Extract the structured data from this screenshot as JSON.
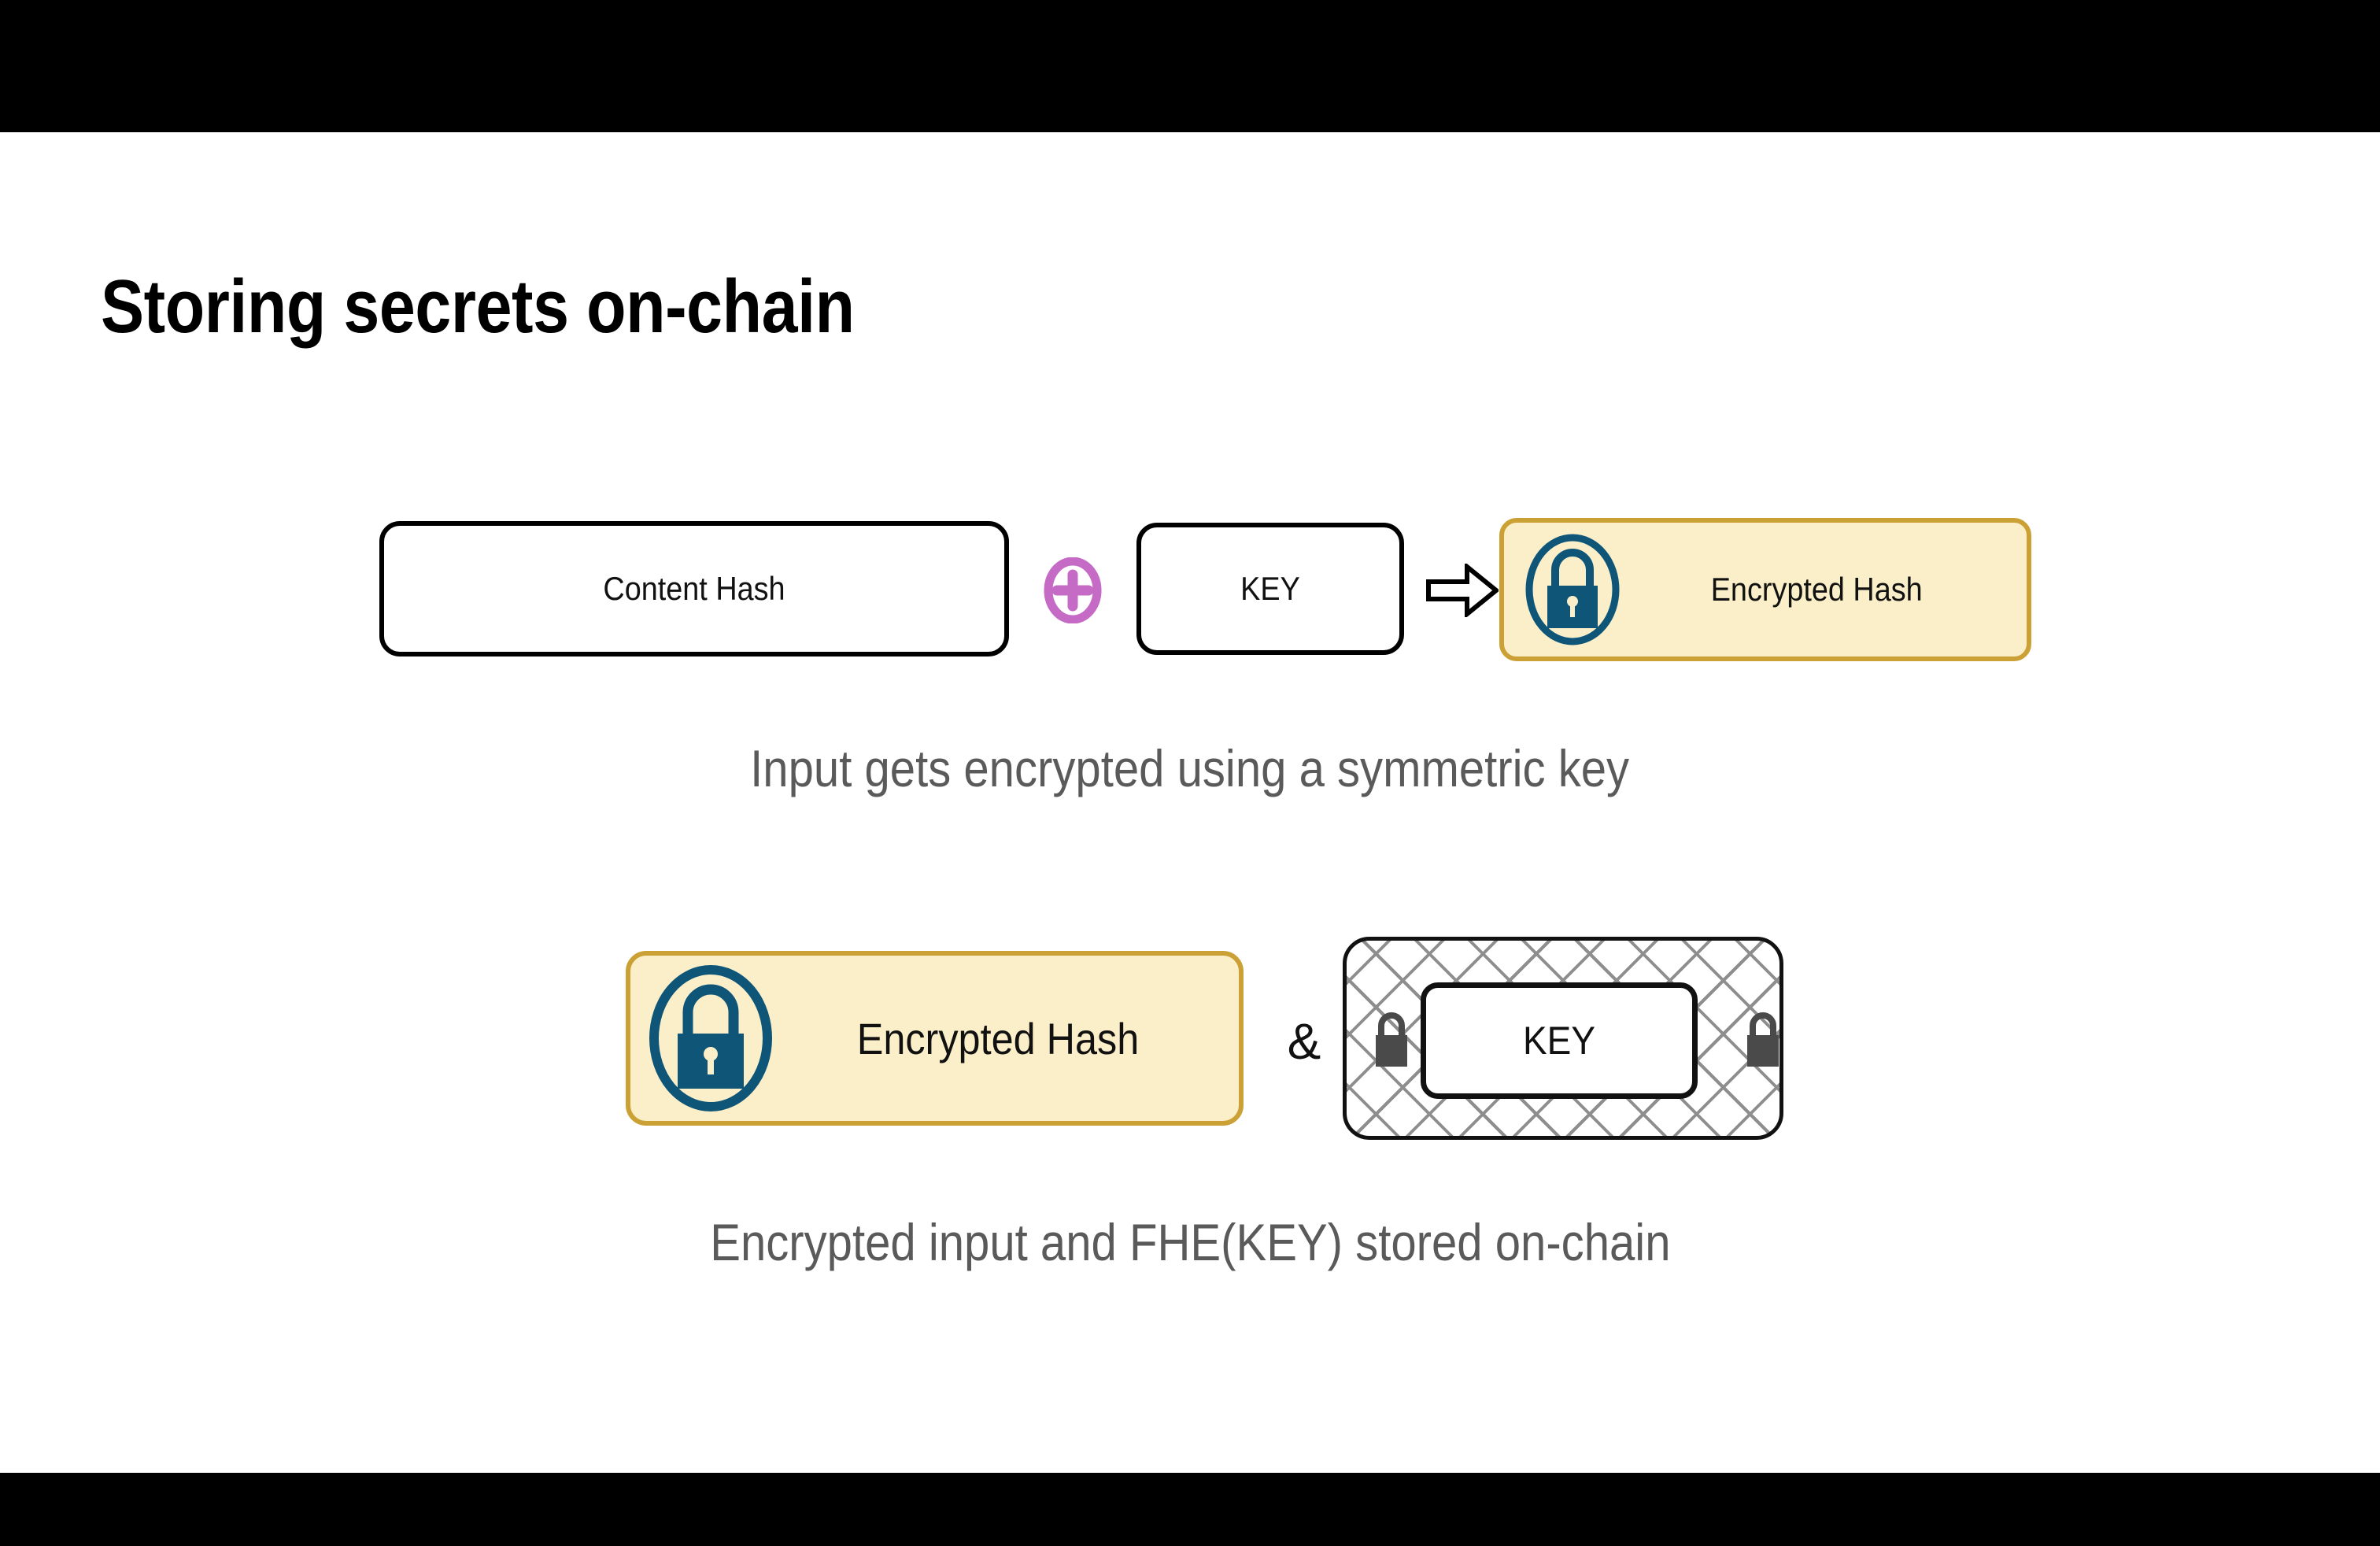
{
  "slide": {
    "title": "Storing secrets on-chain",
    "background_color": "#FFFFFF",
    "letterbox_color": "#000000"
  },
  "diagram": {
    "row1": {
      "content_hash_label": "Content Hash",
      "plus_operator": "plus-circle",
      "key_label": "KEY",
      "arrow": "right-block-arrow",
      "encrypted_hash_label": "Encrypted Hash",
      "lock_icon": "lock-in-circle-icon",
      "caption": "Input gets encrypted using a symmetric key",
      "accent_fill": "#FBEFC9",
      "accent_border": "#CBA135",
      "lock_color": "#0E5578",
      "plus_color": "#C56BC5"
    },
    "row2": {
      "encrypted_hash_label": "Encrypted Hash",
      "lock_icon": "lock-in-circle-icon",
      "conjunction": "&",
      "key_label": "KEY",
      "padlock_left_icon": "padlock-icon",
      "padlock_right_icon": "padlock-icon",
      "caption": "Encrypted input and FHE(KEY) stored on-chain",
      "accent_fill": "#FBEFC9",
      "accent_border": "#CBA135",
      "padlock_color": "#4A4A4A",
      "hatch_color": "#8E8E8E"
    }
  },
  "caption_color": "#5A5A5A"
}
